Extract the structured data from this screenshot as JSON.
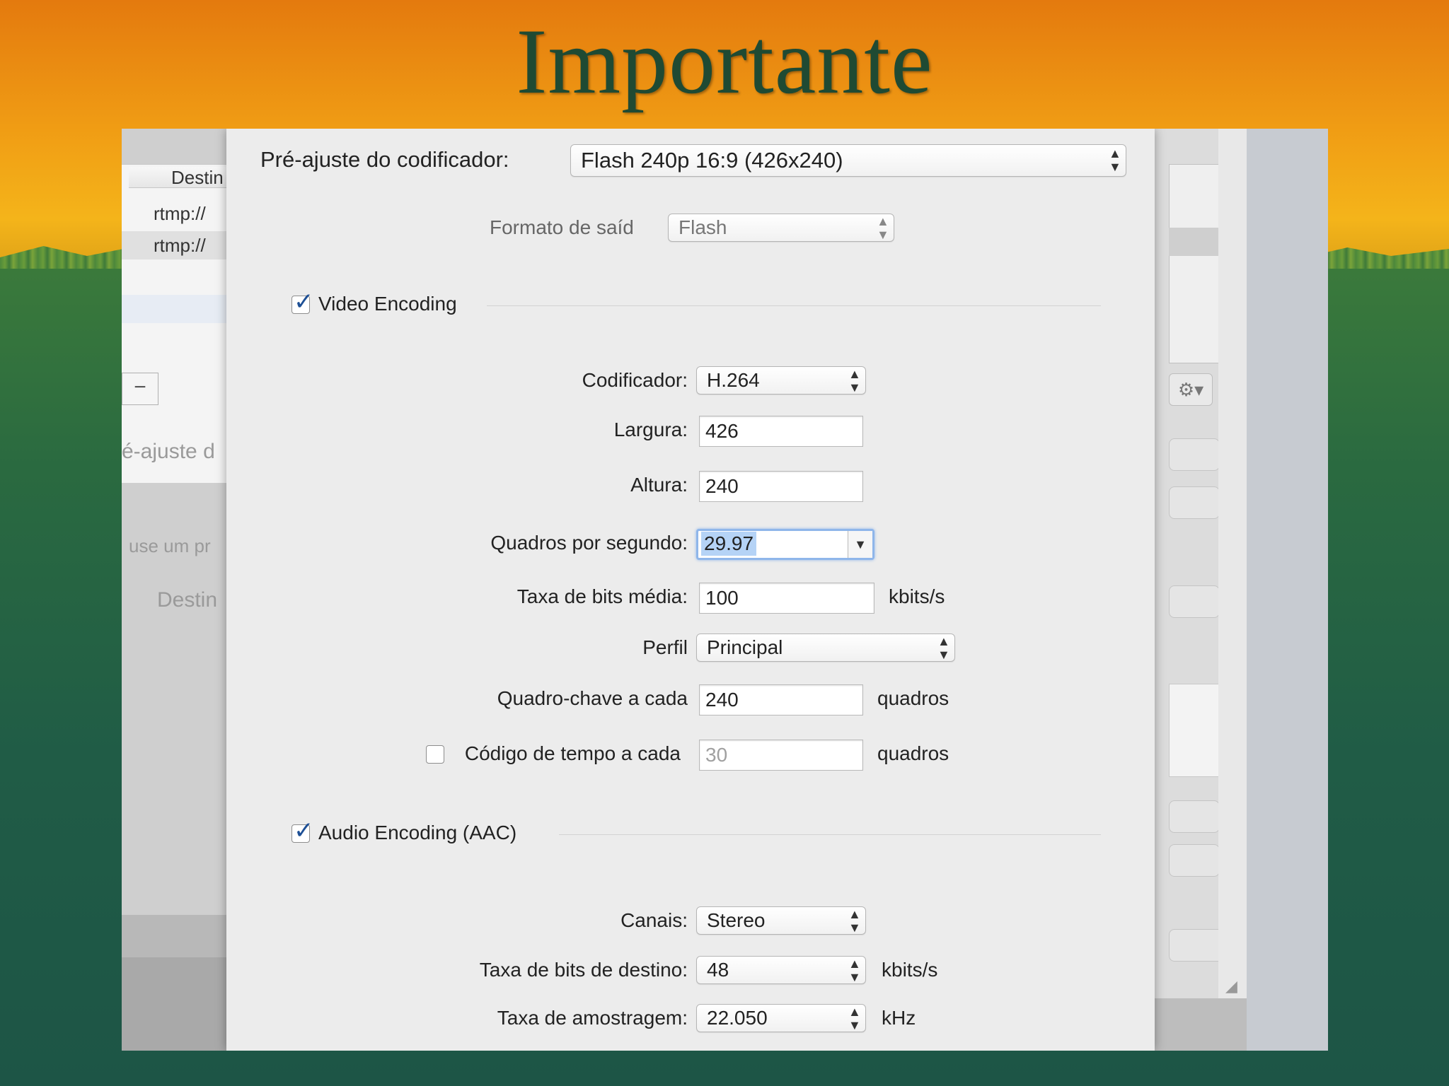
{
  "slide": {
    "title": "Importante"
  },
  "background_window": {
    "column_header": "Destin",
    "rows": [
      "rtmp://",
      "rtmp://"
    ],
    "minus_button": "−",
    "faded_label_1": "é-ajuste d",
    "faded_label_2": "use um pr",
    "faded_label_3": "Destin",
    "gear_icon": "gear-icon",
    "gear_label": "⚙▾"
  },
  "encoder": {
    "preset_label": "Pré-ajuste do codificador:",
    "preset_value": "Flash 240p 16:9 (426x240)",
    "output_format_label": "Formato de saíd",
    "output_format_value": "Flash",
    "video_section_label": "Video Encoding",
    "video_enabled": true,
    "codec_label": "Codificador:",
    "codec_value": "H.264",
    "width_label": "Largura:",
    "width_value": "426",
    "height_label": "Altura:",
    "height_value": "240",
    "fps_label": "Quadros por segundo:",
    "fps_value": "29.97",
    "avg_bitrate_label": "Taxa de bits média:",
    "avg_bitrate_value": "100",
    "avg_bitrate_unit": "kbits/s",
    "profile_label": "Perfil",
    "profile_value": "Principal",
    "keyframe_label": "Quadro-chave a cada",
    "keyframe_value": "240",
    "keyframe_unit": "quadros",
    "timecode_label": "Código de tempo a cada",
    "timecode_enabled": false,
    "timecode_value": "30",
    "timecode_unit": "quadros",
    "audio_section_label": "Audio Encoding (AAC)",
    "audio_enabled": true,
    "channels_label": "Canais:",
    "channels_value": "Stereo",
    "target_bitrate_label": "Taxa de bits de destino:",
    "target_bitrate_value": "48",
    "target_bitrate_unit": "kbits/s",
    "sample_rate_label": "Taxa de amostragem:",
    "sample_rate_value": "22.050",
    "sample_rate_unit": "kHz"
  },
  "colors": {
    "title": "#1f4a33",
    "checkbox_mark": "#1d4f95",
    "focus_ring": "#8fb6ea",
    "selection": "#b5d3f6"
  }
}
